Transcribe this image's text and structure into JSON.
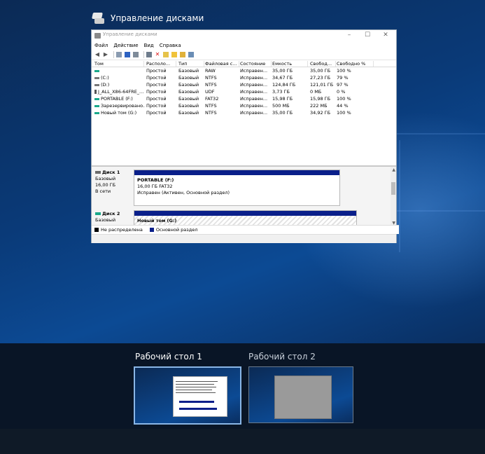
{
  "app_caption": {
    "title": "Управление дисками",
    "icon": "disk-management-icon"
  },
  "window": {
    "title": "Управление дисками",
    "buttons": {
      "minimize": "–",
      "maximize": "☐",
      "close": "✕"
    },
    "menu": [
      "Файл",
      "Действие",
      "Вид",
      "Справка"
    ]
  },
  "volumes": {
    "columns": [
      "Том",
      "Располо...",
      "Тип",
      "Файловая с...",
      "Состояние",
      "Емкость",
      "Свобод...",
      "Свободно %"
    ],
    "rows": [
      [
        "",
        "Простой",
        "Базовый",
        "RAW",
        "Исправен...",
        "35,00 ГБ",
        "35,00 ГБ",
        "100 %"
      ],
      [
        "(C:)",
        "Простой",
        "Базовый",
        "NTFS",
        "Исправен...",
        "34,67 ГБ",
        "27,23 ГБ",
        "79 %"
      ],
      [
        "(D:)",
        "Простой",
        "Базовый",
        "NTFS",
        "Исправен...",
        "124,84 ГБ",
        "121,01 ГБ",
        "97 %"
      ],
      [
        "J_ALL_X86-64FRE_...",
        "Простой",
        "Базовый",
        "UDF",
        "Исправен...",
        "3,73 ГБ",
        "0 МБ",
        "0 %"
      ],
      [
        "PORTABLE (F:)",
        "Простой",
        "Базовый",
        "FAT32",
        "Исправен...",
        "15,98 ГБ",
        "15,98 ГБ",
        "100 %"
      ],
      [
        "Зарезервировано...",
        "Простой",
        "Базовый",
        "NTFS",
        "Исправен...",
        "500 МБ",
        "222 МБ",
        "44 %"
      ],
      [
        "Новый том (G:)",
        "Простой",
        "Базовый",
        "NTFS",
        "Исправен...",
        "35,00 ГБ",
        "34,92 ГБ",
        "100 %"
      ]
    ]
  },
  "disks": [
    {
      "name": "Диск 1",
      "type": "Базовый",
      "size": "16,00 ГБ",
      "status": "В сети",
      "partition": {
        "title": "PORTABLE  (F:)",
        "detail": "16,00 ГБ FAT32",
        "state": "Исправен (Активен, Основной раздел)"
      }
    },
    {
      "name": "Диск 2",
      "type": "Базовый",
      "partition": {
        "title": "Новый том  (G:)"
      }
    }
  ],
  "legend": [
    {
      "label": "Не распределена",
      "color": "#000000"
    },
    {
      "label": "Основной раздел",
      "color": "#0a1f8a"
    }
  ],
  "desktops": [
    {
      "label": "Рабочий стол 1",
      "active": true
    },
    {
      "label": "Рабочий стол 2",
      "active": false
    }
  ],
  "colors": {
    "accent": "#8ab6e6",
    "partition_stripe": "#0a1f8a"
  }
}
